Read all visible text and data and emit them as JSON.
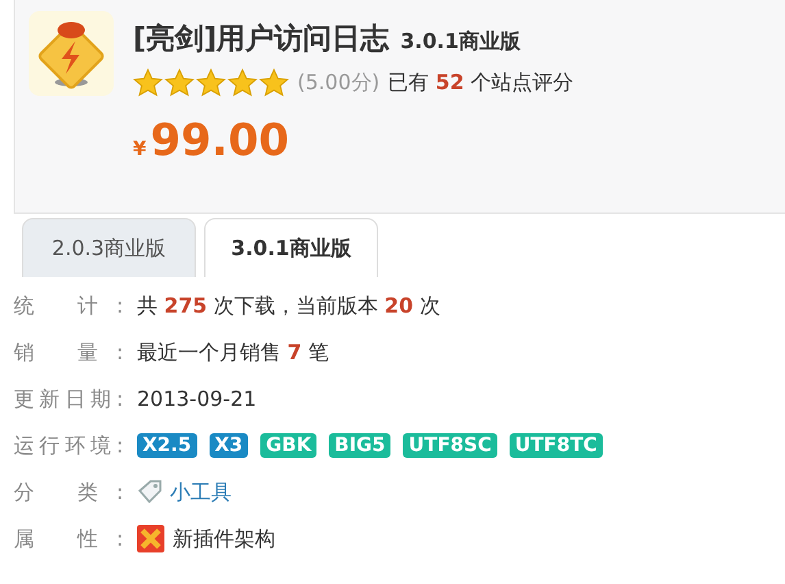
{
  "product": {
    "title": "[亮剑]用户访问日志",
    "version": "3.0.1商业版",
    "stars": 5,
    "score": "(5.00分)",
    "rating_text": "已有 **52** 个站点评分",
    "currency": "¥",
    "price": "99.00"
  },
  "tabs": [
    {
      "label": "2.0.3商业版",
      "selected": false
    },
    {
      "label": "3.0.1商业版",
      "selected": true
    }
  ],
  "info": [
    {
      "kind": "text",
      "label": "统 计:",
      "value": "共 **275** 次下载，当前版本 **20** 次"
    },
    {
      "kind": "text",
      "label": "销 量:",
      "value": "最近一个月销售 **7** 笔"
    },
    {
      "kind": "plain",
      "label": "更新日期:",
      "value": "2013-09-21"
    },
    {
      "kind": "badges",
      "label": "运行环境:",
      "badges": [
        {
          "text": "X2.5",
          "color": "#1a8ac4"
        },
        {
          "text": "X3",
          "color": "#1a8ac4"
        },
        {
          "text": "GBK",
          "color": "#1bbc9b"
        },
        {
          "text": "BIG5",
          "color": "#1bbc9b"
        },
        {
          "text": "UTF8SC",
          "color": "#1bbc9b"
        },
        {
          "text": "UTF8TC",
          "color": "#1bbc9b"
        }
      ]
    },
    {
      "kind": "link",
      "label": "分 类:",
      "value": "小工具"
    },
    {
      "kind": "feature",
      "label": "属 性:",
      "value": "新插件架构"
    }
  ]
}
